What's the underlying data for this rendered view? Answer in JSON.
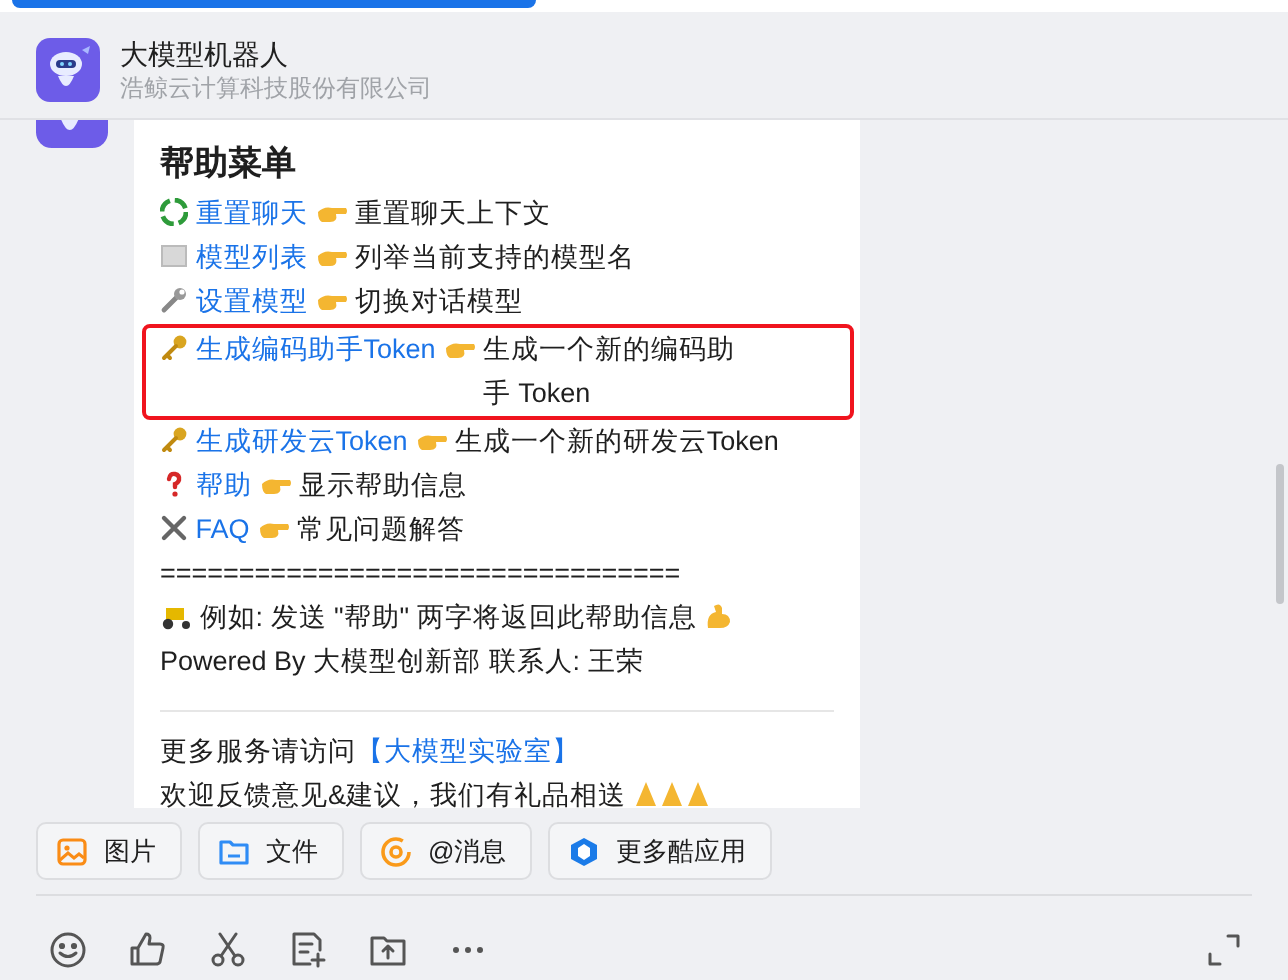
{
  "header": {
    "title": "大模型机器人",
    "subtitle": "浩鲸云计算科技股份有限公司"
  },
  "message": {
    "heading": "帮助菜单",
    "commands": [
      {
        "kind": "recycle",
        "command": "重置聊天",
        "description": "重置聊天上下文",
        "highlighted": false
      },
      {
        "kind": "book",
        "command": "模型列表",
        "description": "列举当前支持的模型名",
        "highlighted": false
      },
      {
        "kind": "wrench",
        "command": "设置模型",
        "description": "切换对话模型",
        "highlighted": false
      },
      {
        "kind": "key",
        "command": "生成编码助手Token",
        "description": "生成一个新的编码助手 Token",
        "highlighted": true
      },
      {
        "kind": "key",
        "command": "生成研发云Token",
        "description": "生成一个新的研发云Token",
        "highlighted": false
      },
      {
        "kind": "question",
        "command": "帮助",
        "description": "显示帮助信息",
        "highlighted": false
      },
      {
        "kind": "tools",
        "command": "FAQ",
        "description": "常见问题解答",
        "highlighted": false
      }
    ],
    "separator": "=================================",
    "example": "例如: 发送 \"帮助\" 两字将返回此帮助信息",
    "powered": "Powered By 大模型创新部 联系人: 王荣",
    "service_text": "更多服务请访问",
    "service_link": "【大模型实验室】",
    "feedback": "欢迎反馈意见&建议，我们有礼品相送"
  },
  "quick_actions": [
    {
      "kind": "image",
      "label": "图片"
    },
    {
      "kind": "folder",
      "label": "文件"
    },
    {
      "kind": "mention",
      "label": "@消息"
    },
    {
      "kind": "apps",
      "label": "更多酷应用"
    }
  ]
}
